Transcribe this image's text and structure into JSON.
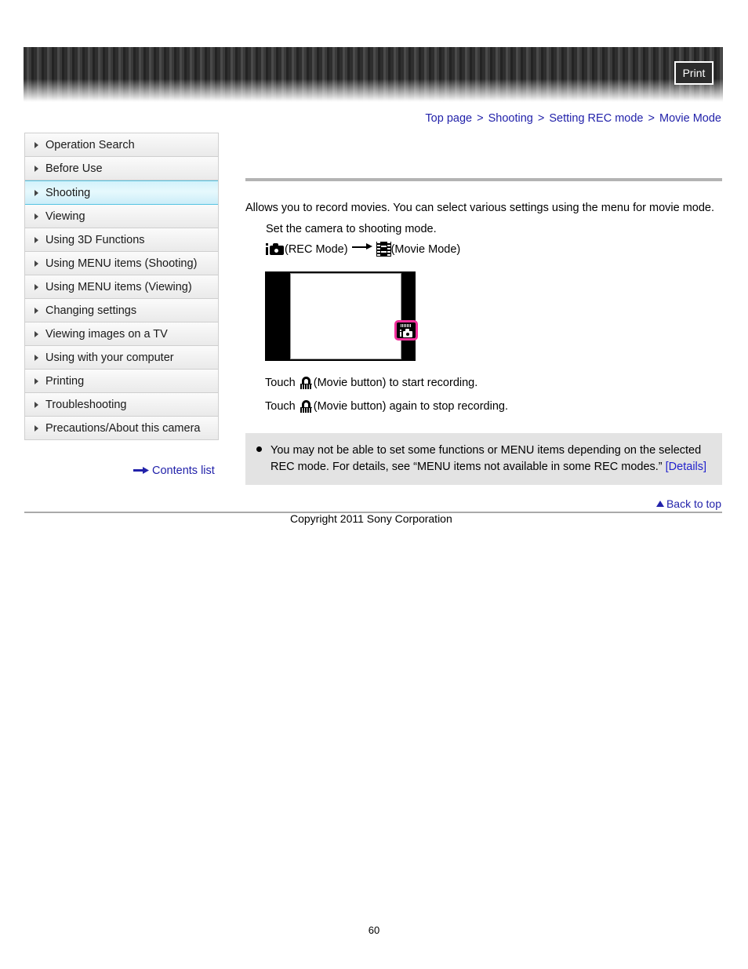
{
  "header": {
    "print_label": "Print",
    "print_icon": "printer-icon"
  },
  "breadcrumb": {
    "items": [
      "Top page",
      "Shooting",
      "Setting REC mode",
      "Movie Mode"
    ],
    "separator": ">",
    "link_color": "#2222aa"
  },
  "sidebar": {
    "items": [
      {
        "label": "Operation Search",
        "active": false
      },
      {
        "label": "Before Use",
        "active": false
      },
      {
        "label": "Shooting",
        "active": true
      },
      {
        "label": "Viewing",
        "active": false
      },
      {
        "label": "Using 3D Functions",
        "active": false
      },
      {
        "label": "Using MENU items (Shooting)",
        "active": false
      },
      {
        "label": "Using MENU items (Viewing)",
        "active": false
      },
      {
        "label": "Changing settings",
        "active": false
      },
      {
        "label": "Viewing images on a TV",
        "active": false
      },
      {
        "label": "Using with your computer",
        "active": false
      },
      {
        "label": "Printing",
        "active": false
      },
      {
        "label": "Troubleshooting",
        "active": false
      },
      {
        "label": "Precautions/About this camera",
        "active": false
      }
    ],
    "bullet_icon": "triangle-right-icon",
    "active_color": "#56c4e2",
    "contents_list": {
      "label": "Contents list",
      "icon": "arrow-right-icon"
    }
  },
  "main": {
    "intro": "Allows you to record movies. You can select various settings using the menu for movie mode.",
    "step": "Set the camera to shooting mode.",
    "mode_path": {
      "rec_icon": "rec-mode-camera-icon",
      "rec_label": "(REC Mode)",
      "arrow_icon": "arrow-right-icon",
      "movie_icon": "film-strip-icon",
      "movie_label": "(Movie Mode)"
    },
    "figure": {
      "name": "camera-screen-illustration",
      "highlight_icon": "rec-mode-button-icon",
      "highlight_color": "#f0309b"
    },
    "touch_lines": [
      {
        "prefix": "Touch ",
        "icon": "movie-button-icon",
        "suffix": "(Movie button) to start recording."
      },
      {
        "prefix": "Touch ",
        "icon": "movie-button-icon",
        "suffix": "(Movie button) again to stop recording."
      }
    ],
    "note": {
      "bullet_icon": "bullet-dot-icon",
      "text": "You may not be able to set some functions or MENU items depending on the selected REC mode. For details, see “MENU items not available in some REC modes.” ",
      "link_label": "[Details]"
    }
  },
  "footer": {
    "back_to_top": "Back to top",
    "back_to_top_icon": "triangle-up-icon",
    "copyright": "Copyright 2011 Sony Corporation",
    "page_number": "60"
  }
}
